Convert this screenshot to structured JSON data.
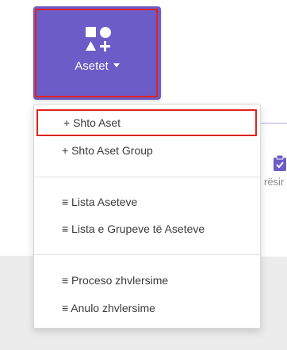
{
  "assets_button": {
    "label": "Asetet",
    "icon": "shapes-icon",
    "color": "#6b5cc7"
  },
  "dropdown": {
    "items": [
      {
        "label": "+ Shto Aset",
        "highlighted": true
      },
      {
        "label": "+ Shto Aset Group"
      },
      {
        "label": "≡ Lista Aseteve"
      },
      {
        "label": "≡ Lista e Grupeve të Aseteve"
      },
      {
        "label": "≡ Proceso zhvlersime"
      },
      {
        "label": "≡ Anulo zhvlersime"
      }
    ]
  },
  "side_card": {
    "text": "rësir",
    "icon": "clipboard-check-icon"
  },
  "colors": {
    "highlight": "#e0231c",
    "accent": "#6b5cc7"
  }
}
